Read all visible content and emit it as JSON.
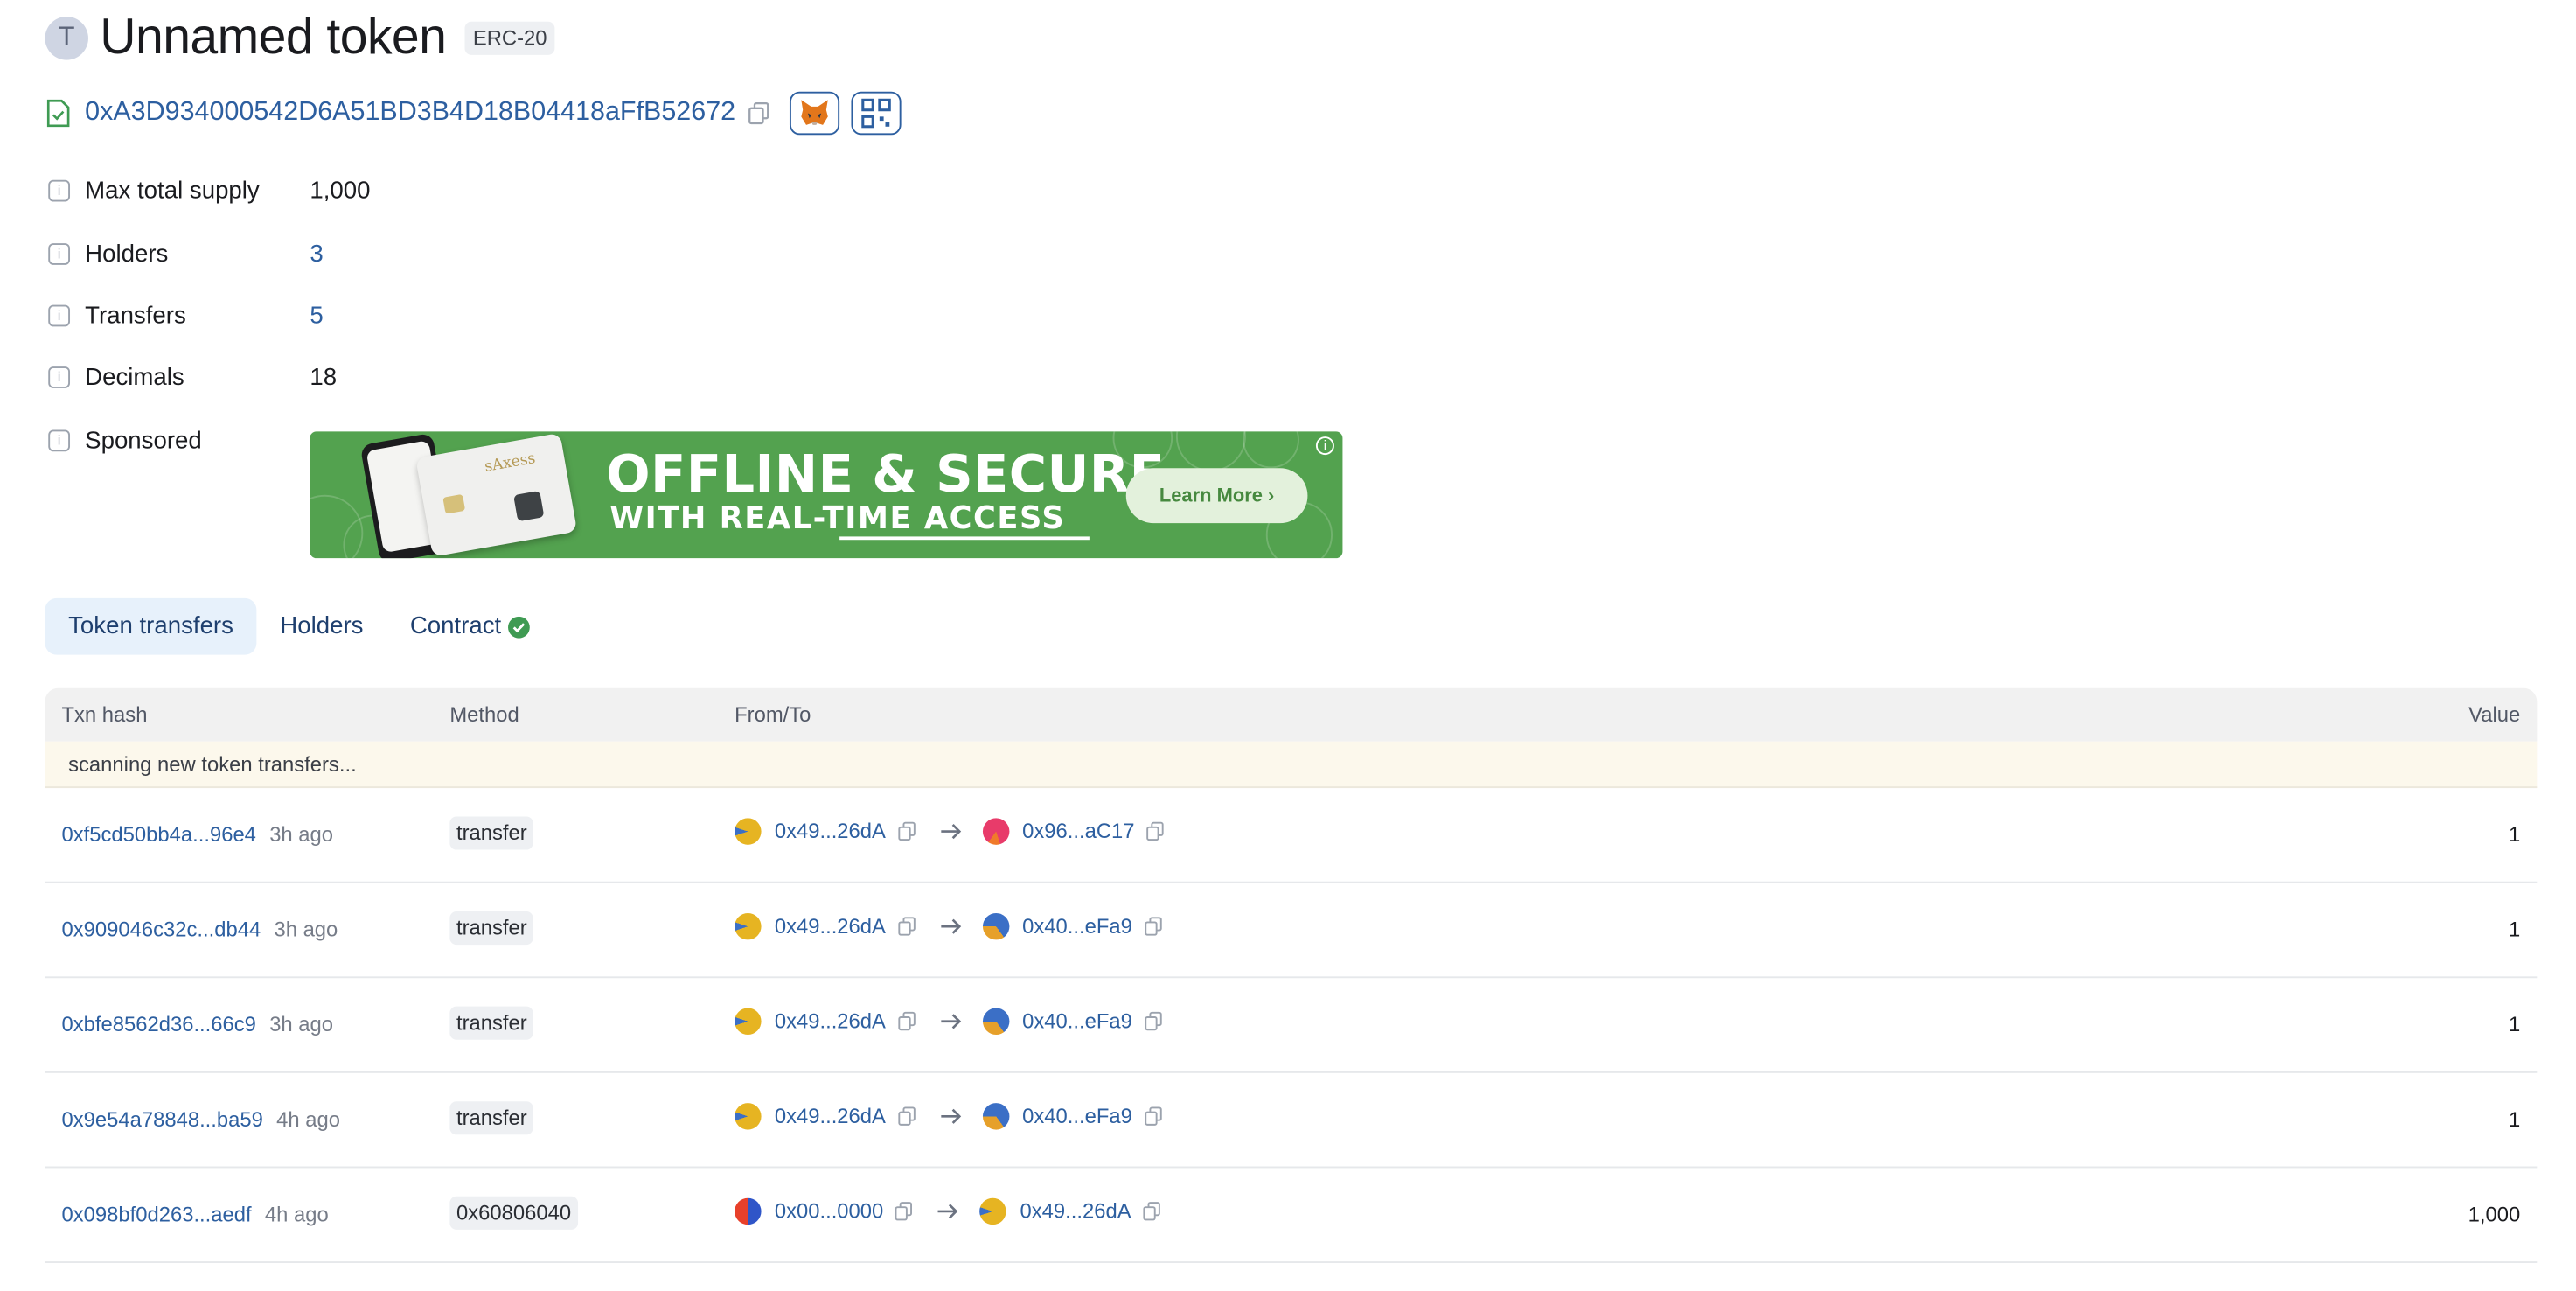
{
  "token": {
    "avatar_letter": "T",
    "title": "Unnamed token",
    "standard": "ERC-20",
    "address": "0xA3D934000542D6A51BD3B4D18B04418aFfB52672"
  },
  "details": [
    {
      "label": "Max total supply",
      "value": "1,000"
    },
    {
      "label": "Holders",
      "value": "3"
    },
    {
      "label": "Transfers",
      "value": "5"
    },
    {
      "label": "Decimals",
      "value": "18"
    },
    {
      "label": "Sponsored",
      "value": ""
    }
  ],
  "ad": {
    "line1": "OFFLINE & SECURE",
    "line2": "WITH REAL-TIME ACCESS",
    "button": "Learn More ›",
    "card_brand": "sAxess",
    "background_color": "#53a24f"
  },
  "tabs": [
    {
      "label": "Token transfers",
      "active": true
    },
    {
      "label": "Holders",
      "active": false
    },
    {
      "label": "Contract",
      "active": false,
      "icon": "verified-check-icon"
    }
  ],
  "table": {
    "headers": {
      "hash": "Txn hash",
      "method": "Method",
      "fromto": "From/To",
      "value": "Value"
    },
    "scanning": "scanning new token transfers...",
    "rows": [
      {
        "hash": "0xf5cd50bb4a...96e4",
        "age": "3h ago",
        "method": "transfer",
        "from": "0x49...26dA",
        "to": "0x96...aC17",
        "value": "1"
      },
      {
        "hash": "0x909046c32c...db44",
        "age": "3h ago",
        "method": "transfer",
        "from": "0x49...26dA",
        "to": "0x40...eFa9",
        "value": "1"
      },
      {
        "hash": "0xbfe8562d36...66c9",
        "age": "3h ago",
        "method": "transfer",
        "from": "0x49...26dA",
        "to": "0x40...eFa9",
        "value": "1"
      },
      {
        "hash": "0x9e54a78848...ba59",
        "age": "4h ago",
        "method": "transfer",
        "from": "0x49...26dA",
        "to": "0x40...eFa9",
        "value": "1"
      },
      {
        "hash": "0x098bf0d263...aedf",
        "age": "4h ago",
        "method": "0x60806040",
        "from": "0x00...0000",
        "to": "0x49...26dA",
        "value": "1,000"
      }
    ]
  },
  "colors": {
    "link": "#2d5fa0",
    "tab_active_bg": "#e7f1fb",
    "verified": "#3f9b53"
  }
}
